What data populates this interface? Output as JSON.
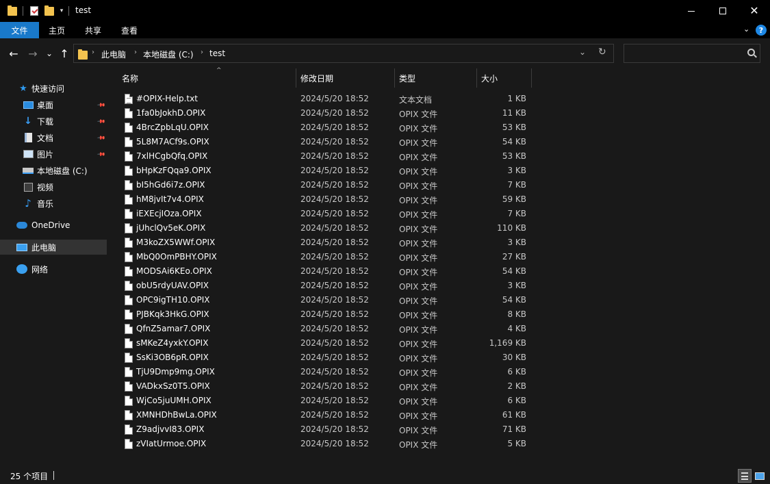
{
  "window": {
    "title": "test",
    "minimize_label": "",
    "close_glyph": "✕"
  },
  "quick_access_icons": [
    "folder-icon",
    "properties-icon",
    "new-folder-icon",
    "customize-dropdown-icon"
  ],
  "ribbon": {
    "tabs": [
      "文件",
      "主页",
      "共享",
      "查看"
    ],
    "help_glyph": "?",
    "collapse_glyph": "⌄"
  },
  "nav": {
    "back_glyph": "←",
    "forward_glyph": "→",
    "recent_glyph": "⌄",
    "up_glyph": "↑",
    "breadcrumbs": [
      "此电脑",
      "本地磁盘 (C:)",
      "test"
    ],
    "crumb_separator": "›",
    "dropdown_glyph": "⌄",
    "refresh_glyph": "↻",
    "search_placeholder": ""
  },
  "sidebar": {
    "items": [
      {
        "label": "快速访问",
        "icon": "star-icon",
        "glyph": "★",
        "pinned": false
      },
      {
        "label": "桌面",
        "icon": "desktop-icon",
        "glyph": "",
        "pinned": true
      },
      {
        "label": "下载",
        "icon": "download-icon",
        "glyph": "↓",
        "pinned": true
      },
      {
        "label": "文档",
        "icon": "documents-icon",
        "glyph": "",
        "pinned": true
      },
      {
        "label": "图片",
        "icon": "pictures-icon",
        "glyph": "",
        "pinned": true
      },
      {
        "label": "本地磁盘 (C:)",
        "icon": "drive-icon",
        "glyph": "",
        "pinned": false
      },
      {
        "label": "视频",
        "icon": "videos-icon",
        "glyph": "",
        "pinned": false
      },
      {
        "label": "音乐",
        "icon": "music-icon",
        "glyph": "♪",
        "pinned": false
      },
      {
        "label": "OneDrive",
        "icon": "onedrive-icon",
        "glyph": "",
        "pinned": false
      },
      {
        "label": "此电脑",
        "icon": "this-pc-icon",
        "glyph": "",
        "pinned": false
      },
      {
        "label": "网络",
        "icon": "network-icon",
        "glyph": "",
        "pinned": false
      }
    ],
    "pin_glyph": "📌",
    "selected": "此电脑"
  },
  "columns": {
    "name": "名称",
    "modified": "修改日期",
    "type": "类型",
    "size": "大小",
    "sort_glyph": "^"
  },
  "files": [
    {
      "name": "#OPIX-Help.txt",
      "modified": "2024/5/20 18:52",
      "type": "文本文档",
      "size": "1 KB",
      "kind": "txt"
    },
    {
      "name": "1fa0bJokhD.OPIX",
      "modified": "2024/5/20 18:52",
      "type": "OPIX 文件",
      "size": "11 KB",
      "kind": "file"
    },
    {
      "name": "4BrcZpbLqU.OPIX",
      "modified": "2024/5/20 18:52",
      "type": "OPIX 文件",
      "size": "53 KB",
      "kind": "file"
    },
    {
      "name": "5L8M7ACf9s.OPIX",
      "modified": "2024/5/20 18:52",
      "type": "OPIX 文件",
      "size": "54 KB",
      "kind": "file"
    },
    {
      "name": "7xlHCgbQfq.OPIX",
      "modified": "2024/5/20 18:52",
      "type": "OPIX 文件",
      "size": "53 KB",
      "kind": "file"
    },
    {
      "name": "bHpKzFQqa9.OPIX",
      "modified": "2024/5/20 18:52",
      "type": "OPIX 文件",
      "size": "3 KB",
      "kind": "file"
    },
    {
      "name": "bI5hGd6i7z.OPIX",
      "modified": "2024/5/20 18:52",
      "type": "OPIX 文件",
      "size": "7 KB",
      "kind": "file"
    },
    {
      "name": "hM8jvIt7v4.OPIX",
      "modified": "2024/5/20 18:52",
      "type": "OPIX 文件",
      "size": "59 KB",
      "kind": "file"
    },
    {
      "name": "iEXEcjIOza.OPIX",
      "modified": "2024/5/20 18:52",
      "type": "OPIX 文件",
      "size": "7 KB",
      "kind": "file"
    },
    {
      "name": "jUhclQv5eK.OPIX",
      "modified": "2024/5/20 18:52",
      "type": "OPIX 文件",
      "size": "110 KB",
      "kind": "file"
    },
    {
      "name": "M3koZX5WWf.OPIX",
      "modified": "2024/5/20 18:52",
      "type": "OPIX 文件",
      "size": "3 KB",
      "kind": "file"
    },
    {
      "name": "MbQ0OmPBHY.OPIX",
      "modified": "2024/5/20 18:52",
      "type": "OPIX 文件",
      "size": "27 KB",
      "kind": "file"
    },
    {
      "name": "MODSAi6KEo.OPIX",
      "modified": "2024/5/20 18:52",
      "type": "OPIX 文件",
      "size": "54 KB",
      "kind": "file"
    },
    {
      "name": "obU5rdyUAV.OPIX",
      "modified": "2024/5/20 18:52",
      "type": "OPIX 文件",
      "size": "3 KB",
      "kind": "file"
    },
    {
      "name": "OPC9igTH10.OPIX",
      "modified": "2024/5/20 18:52",
      "type": "OPIX 文件",
      "size": "54 KB",
      "kind": "file"
    },
    {
      "name": "PJBKqk3HkG.OPIX",
      "modified": "2024/5/20 18:52",
      "type": "OPIX 文件",
      "size": "8 KB",
      "kind": "file"
    },
    {
      "name": "QfnZ5amar7.OPIX",
      "modified": "2024/5/20 18:52",
      "type": "OPIX 文件",
      "size": "4 KB",
      "kind": "file"
    },
    {
      "name": "sMKeZ4yxkY.OPIX",
      "modified": "2024/5/20 18:52",
      "type": "OPIX 文件",
      "size": "1,169 KB",
      "kind": "file"
    },
    {
      "name": "SsKi3OB6pR.OPIX",
      "modified": "2024/5/20 18:52",
      "type": "OPIX 文件",
      "size": "30 KB",
      "kind": "file"
    },
    {
      "name": "TjU9Dmp9mg.OPIX",
      "modified": "2024/5/20 18:52",
      "type": "OPIX 文件",
      "size": "6 KB",
      "kind": "file"
    },
    {
      "name": "VADkxSz0T5.OPIX",
      "modified": "2024/5/20 18:52",
      "type": "OPIX 文件",
      "size": "2 KB",
      "kind": "file"
    },
    {
      "name": "WjCo5juUMH.OPIX",
      "modified": "2024/5/20 18:52",
      "type": "OPIX 文件",
      "size": "6 KB",
      "kind": "file"
    },
    {
      "name": "XMNHDhBwLa.OPIX",
      "modified": "2024/5/20 18:52",
      "type": "OPIX 文件",
      "size": "61 KB",
      "kind": "file"
    },
    {
      "name": "Z9adjvvI83.OPIX",
      "modified": "2024/5/20 18:52",
      "type": "OPIX 文件",
      "size": "71 KB",
      "kind": "file"
    },
    {
      "name": "zVIatUrmoe.OPIX",
      "modified": "2024/5/20 18:52",
      "type": "OPIX 文件",
      "size": "5 KB",
      "kind": "file"
    }
  ],
  "status": {
    "item_count": "25 个项目"
  },
  "colors": {
    "accent": "#1979ca",
    "background": "#191919",
    "titlebar": "#000000",
    "selected": "#333333"
  }
}
